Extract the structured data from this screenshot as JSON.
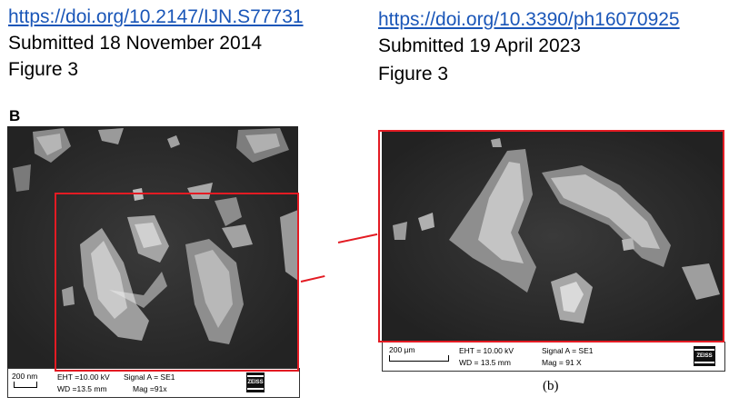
{
  "left": {
    "url": "https://doi.org/10.2147/IJN.S77731",
    "submitted": "Submitted 18 November 2014",
    "figure": "Figure 3",
    "panel_letter": "B",
    "info": {
      "scale": "200 nm",
      "eht": "EHT =10.00 kV",
      "wd": "WD =13.5 mm",
      "signal": "Signal A = SE1",
      "mag": "Mag =91x",
      "logo": "ZEISS"
    }
  },
  "right": {
    "url": "https://doi.org/10.3390/ph16070925",
    "submitted": "Submitted 19 April 2023",
    "figure": "Figure 3",
    "caption": "(b)",
    "info": {
      "scale": "200 µm",
      "eht": "EHT = 10.00 kV",
      "wd": "WD = 13.5 mm",
      "signal": "Signal A = SE1",
      "mag": "Mag = 91 X",
      "logo": "ZEISS"
    }
  },
  "colors": {
    "highlight": "#e31b23",
    "link": "#1a56b8",
    "sem_background": "#2a2a2a"
  }
}
